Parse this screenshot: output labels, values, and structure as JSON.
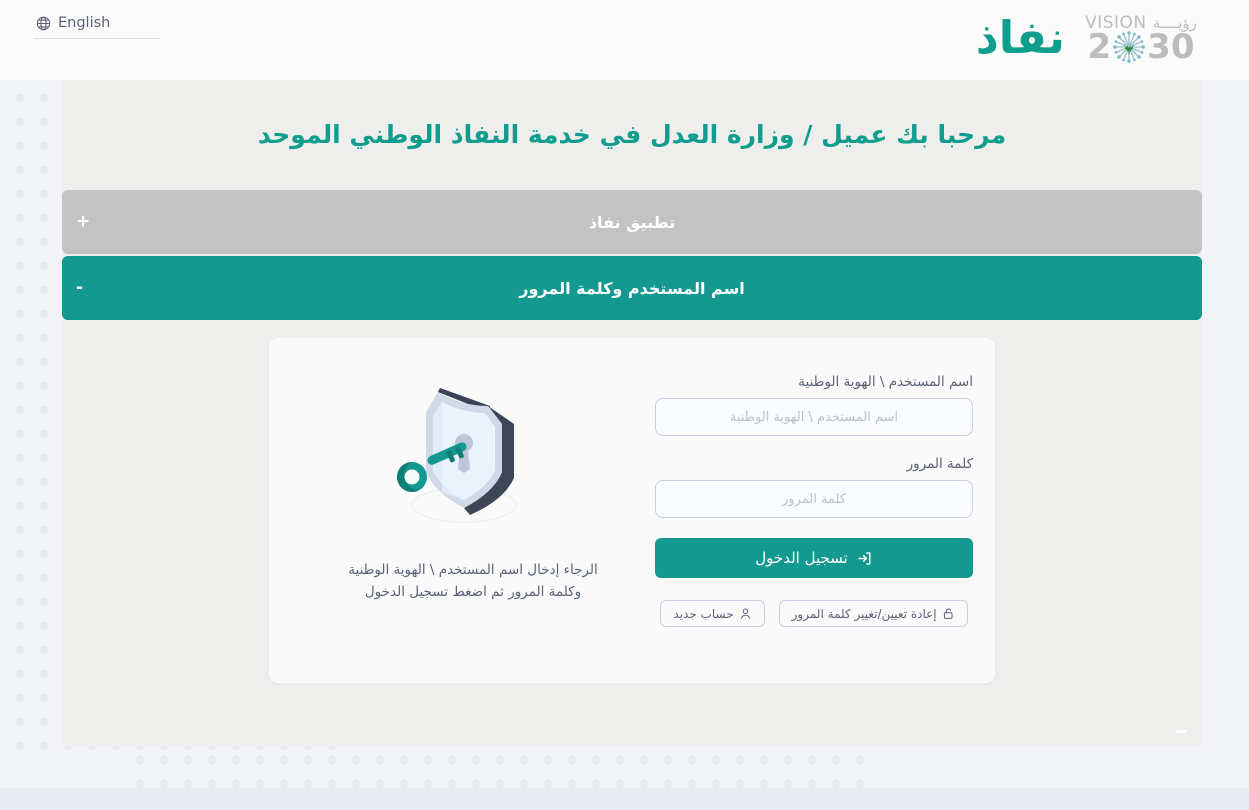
{
  "header": {
    "language_label": "English",
    "globe_icon": "globe-icon",
    "brand_logo_text": "نفاذ",
    "vision_logo": {
      "word_en": "VISION",
      "word_ar": "رؤيــــة",
      "year_prefix": "2",
      "year_suffix": "30",
      "emblem_icon": "saudi-vision-emblem-icon"
    }
  },
  "main": {
    "page_title": "مرحبا بك عميل / وزارة العدل في خدمة النفاذ الوطني الموحد"
  },
  "accordion": {
    "items": [
      {
        "label": "تطبيق نفاذ",
        "sign": "+",
        "state": "collapsed"
      },
      {
        "label": "اسم المستخدم وكلمة المرور",
        "sign": "-",
        "state": "expanded"
      }
    ]
  },
  "login_form": {
    "username": {
      "label": "اسم المستخدم \\ الهوية الوطنية",
      "placeholder": "اسم المستخدم \\ الهوية الوطنية",
      "value": ""
    },
    "password": {
      "label": "كلمة المرور",
      "placeholder": "كلمة المرور",
      "value": ""
    },
    "login_button": {
      "label": "تسجيل الدخول",
      "icon": "sign-in-icon"
    },
    "reset_password_button": {
      "label": "إعادة تعيين/تغيير كلمة المرور",
      "icon": "unlock-icon"
    },
    "new_account_button": {
      "label": "حساب جديد",
      "icon": "person-icon"
    },
    "illustration": "shield-and-key-illustration",
    "helper_text": "الرجاء إدخال اسم المستخدم \\ الهوية الوطنية وكلمة المرور ثم اضغط تسجيل الدخول"
  },
  "colors": {
    "brand_teal": "#139990",
    "accordion_collapsed_gray": "#c3c3c3",
    "panel_background": "#eeeeed",
    "page_background": "#f2f4f8",
    "card_background": "#fafafa",
    "text_muted": "#5b6277",
    "input_border": "#c9cde0",
    "dot_pattern": "#e8eaf0",
    "footer": "#e8eaf0"
  }
}
